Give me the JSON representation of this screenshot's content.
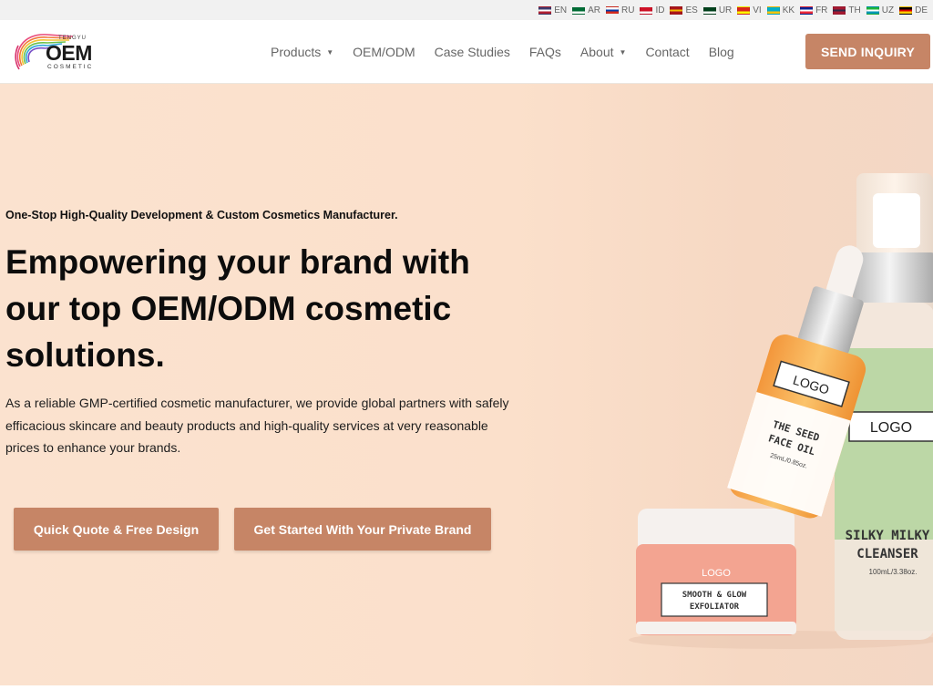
{
  "languages": [
    {
      "code": "EN",
      "flag_colors": [
        "#3c3b6e",
        "#ffffff",
        "#b22234"
      ],
      "icon": "us-flag-icon"
    },
    {
      "code": "AR",
      "flag_colors": [
        "#006c35",
        "#006c35",
        "#ffffff"
      ],
      "icon": "saudi-flag-icon"
    },
    {
      "code": "RU",
      "flag_colors": [
        "#ffffff",
        "#0039a6",
        "#d52b1e"
      ],
      "icon": "russia-flag-icon"
    },
    {
      "code": "ID",
      "flag_colors": [
        "#ce1126",
        "#ce1126",
        "#ffffff"
      ],
      "icon": "indonesia-flag-icon"
    },
    {
      "code": "ES",
      "flag_colors": [
        "#aa151b",
        "#f1bf00",
        "#aa151b"
      ],
      "icon": "spain-flag-icon"
    },
    {
      "code": "UR",
      "flag_colors": [
        "#01411c",
        "#01411c",
        "#ffffff"
      ],
      "icon": "pakistan-flag-icon"
    },
    {
      "code": "VI",
      "flag_colors": [
        "#da251d",
        "#da251d",
        "#ffff00"
      ],
      "icon": "vietnam-flag-icon"
    },
    {
      "code": "KK",
      "flag_colors": [
        "#00afca",
        "#00afca",
        "#fec50c"
      ],
      "icon": "kazakhstan-flag-icon"
    },
    {
      "code": "FR",
      "flag_colors": [
        "#002395",
        "#ffffff",
        "#ed2939"
      ],
      "icon": "france-flag-icon"
    },
    {
      "code": "TH",
      "flag_colors": [
        "#a51931",
        "#2d2a4a",
        "#a51931"
      ],
      "icon": "thailand-flag-icon"
    },
    {
      "code": "UZ",
      "flag_colors": [
        "#1eb53a",
        "#ffffff",
        "#0099b5"
      ],
      "icon": "uzbekistan-flag-icon"
    },
    {
      "code": "DE",
      "flag_colors": [
        "#000000",
        "#dd0000",
        "#ffce00"
      ],
      "icon": "germany-flag-icon"
    }
  ],
  "logo": {
    "small": "TENGYU",
    "big": "OEM",
    "sub": "COSMETIC"
  },
  "nav": [
    {
      "label": "Products",
      "dropdown": true
    },
    {
      "label": "OEM/ODM",
      "dropdown": false
    },
    {
      "label": "Case Studies",
      "dropdown": false
    },
    {
      "label": "FAQs",
      "dropdown": false
    },
    {
      "label": "About",
      "dropdown": true
    },
    {
      "label": "Contact",
      "dropdown": false
    },
    {
      "label": "Blog",
      "dropdown": false
    }
  ],
  "header_cta": "SEND INQUIRY",
  "hero": {
    "eyebrow": "One-Stop High-Quality Development & Custom Cosmetics Manufacturer.",
    "headline": "Empowering your brand with our top OEM/ODM cosmetic solutions.",
    "description": "As a reliable GMP-certified cosmetic manufacturer, we provide global partners with safely efficacious skincare and beauty products and high-quality services at very reasonable prices to enhance your brands.",
    "button_quote": "Quick Quote & Free Design",
    "button_brand": "Get Started With Your Private Brand"
  },
  "product_image": {
    "oil": {
      "logo": "LOGO",
      "name1": "THE SEED",
      "name2": "FACE OIL",
      "size": "25mL/0.85oz."
    },
    "jar": {
      "logo": "LOGO",
      "name1": "SMOOTH & GLOW",
      "name2": "EXFOLIATOR"
    },
    "cleanser": {
      "logo": "LOGO",
      "name1": "SILKY MILKY",
      "name2": "CLEANSER",
      "size": "100mL/3.38oz."
    }
  },
  "colors": {
    "accent": "#c68566",
    "hero_bg": "#fbe2cf",
    "oil_orange": "#f4a24a",
    "jar_pink": "#f3a491",
    "cleanser_green": "#b9d6a4"
  }
}
